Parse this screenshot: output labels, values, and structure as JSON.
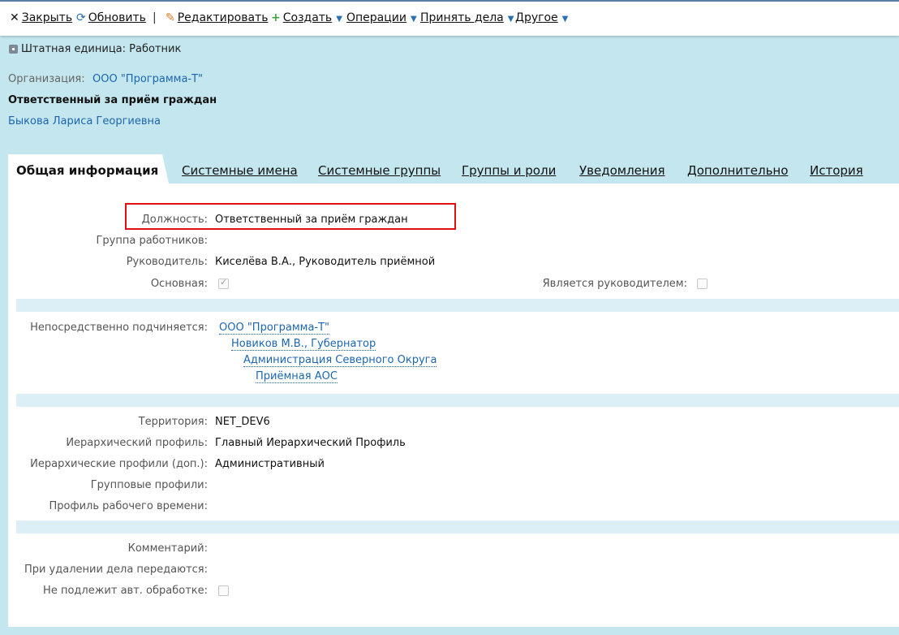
{
  "toolbar": {
    "close": "Закрыть",
    "refresh": "Обновить",
    "separator": "|",
    "edit": "Редактировать",
    "create": "Создать",
    "operations": "Операции",
    "accept_cases": "Принять дела",
    "other": "Другое",
    "caret": "▼"
  },
  "header": {
    "unit_title": "Штатная единица: Работник",
    "org_label": "Организация:",
    "org_value": "ООО \"Программа-Т\"",
    "position_title": "Ответственный за приём граждан",
    "person": "Быкова Лариса Георгиевна"
  },
  "tabs": [
    {
      "label": "Общая информация",
      "active": true
    },
    {
      "label": "Системные имена"
    },
    {
      "label": "Системные группы"
    },
    {
      "label": "Группы и роли"
    },
    {
      "label": "Уведомления"
    },
    {
      "label": "Дополнительно"
    },
    {
      "label": "История"
    }
  ],
  "general": {
    "position_label": "Должность:",
    "position_value": "Ответственный за приём граждан",
    "group_label": "Группа работников:",
    "manager_label": "Руководитель:",
    "manager_value": "Киселёва В.А., Руководитель приёмной",
    "primary_label": "Основная:",
    "primary_checked": true,
    "is_manager_label": "Является руководителем:",
    "is_manager_checked": false
  },
  "subordination": {
    "label": "Непосредственно подчиняется:",
    "chain": [
      "ООО \"Программа-Т\"",
      "Новиков М.В., Губернатор",
      "Администрация Северного Округа",
      "Приёмная АОС"
    ]
  },
  "profiles": {
    "territory_label": "Территория:",
    "territory_value": "NET_DEV6",
    "hier_profile_label": "Иерархический профиль:",
    "hier_profile_value": "Главный Иерархический Профиль",
    "hier_profiles_extra_label": "Иерархические профили (доп.):",
    "hier_profiles_extra_value": "Административный",
    "group_profiles_label": "Групповые профили:",
    "work_time_label": "Профиль рабочего времени:"
  },
  "misc": {
    "comment_label": "Комментарий:",
    "transfer_label": "При удалении дела передаются:",
    "no_auto_label": "Не подлежит авт. обработке:",
    "no_auto_checked": false
  },
  "colors": {
    "background": "#c3e6ef",
    "link": "#1c66b0",
    "highlight": "#e01010"
  }
}
